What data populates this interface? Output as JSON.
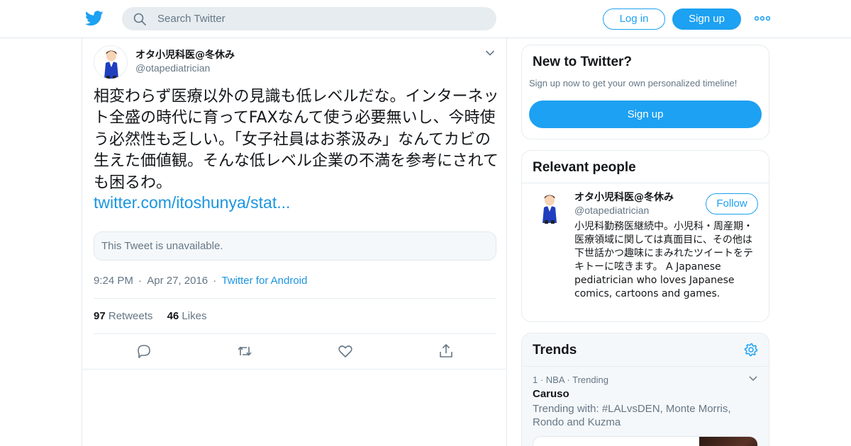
{
  "header": {
    "search_placeholder": "Search Twitter",
    "login_label": "Log in",
    "signup_label": "Sign up",
    "brand_color": "#1da1f2"
  },
  "tweet": {
    "display_name": "オタ小児科医@冬休み",
    "handle": "@otapediatrician",
    "text": "相変わらず医療以外の見識も低レベルだな。インターネット全盛の時代に育ってFAXなんて使う必要無いし、今時使う必然性も乏しい。「女子社員はお茶汲み」なんてカビの生えた価値観。そんな低レベル企業の不満を参考にされても困るわ。",
    "link": "twitter.com/itoshunya/stat...",
    "quoted_unavailable": "This Tweet is unavailable.",
    "time": "9:24 PM",
    "date": "Apr 27, 2016",
    "source": "Twitter for Android",
    "retweets_count": "97",
    "retweets_label": "Retweets",
    "likes_count": "46",
    "likes_label": "Likes",
    "action_icons": [
      "reply-icon",
      "retweet-icon",
      "like-icon",
      "share-icon"
    ]
  },
  "sidebar": {
    "new_to_twitter": {
      "title": "New to Twitter?",
      "subtitle": "Sign up now to get your own personalized timeline!",
      "button_label": "Sign up"
    },
    "relevant_people": {
      "title": "Relevant people",
      "person": {
        "display_name": "オタ小児科医@冬休み",
        "handle": "@otapediatrician",
        "follow_label": "Follow",
        "bio": "小児科勤務医継続中。小児科・周産期・医療領域に関しては真面目に、その他は下世話かつ趣味にまみれたツイートをテキトーに呟きます。 A Japanese pediatrician who loves Japanese comics, cartoons and games."
      }
    },
    "trends": {
      "title": "Trends",
      "items": [
        {
          "meta": "1 · NBA · Trending",
          "name": "Caruso",
          "trending_with": "Trending with: #LALvsDEN, Monte Morris, Rondo and Kuzma"
        }
      ]
    }
  }
}
